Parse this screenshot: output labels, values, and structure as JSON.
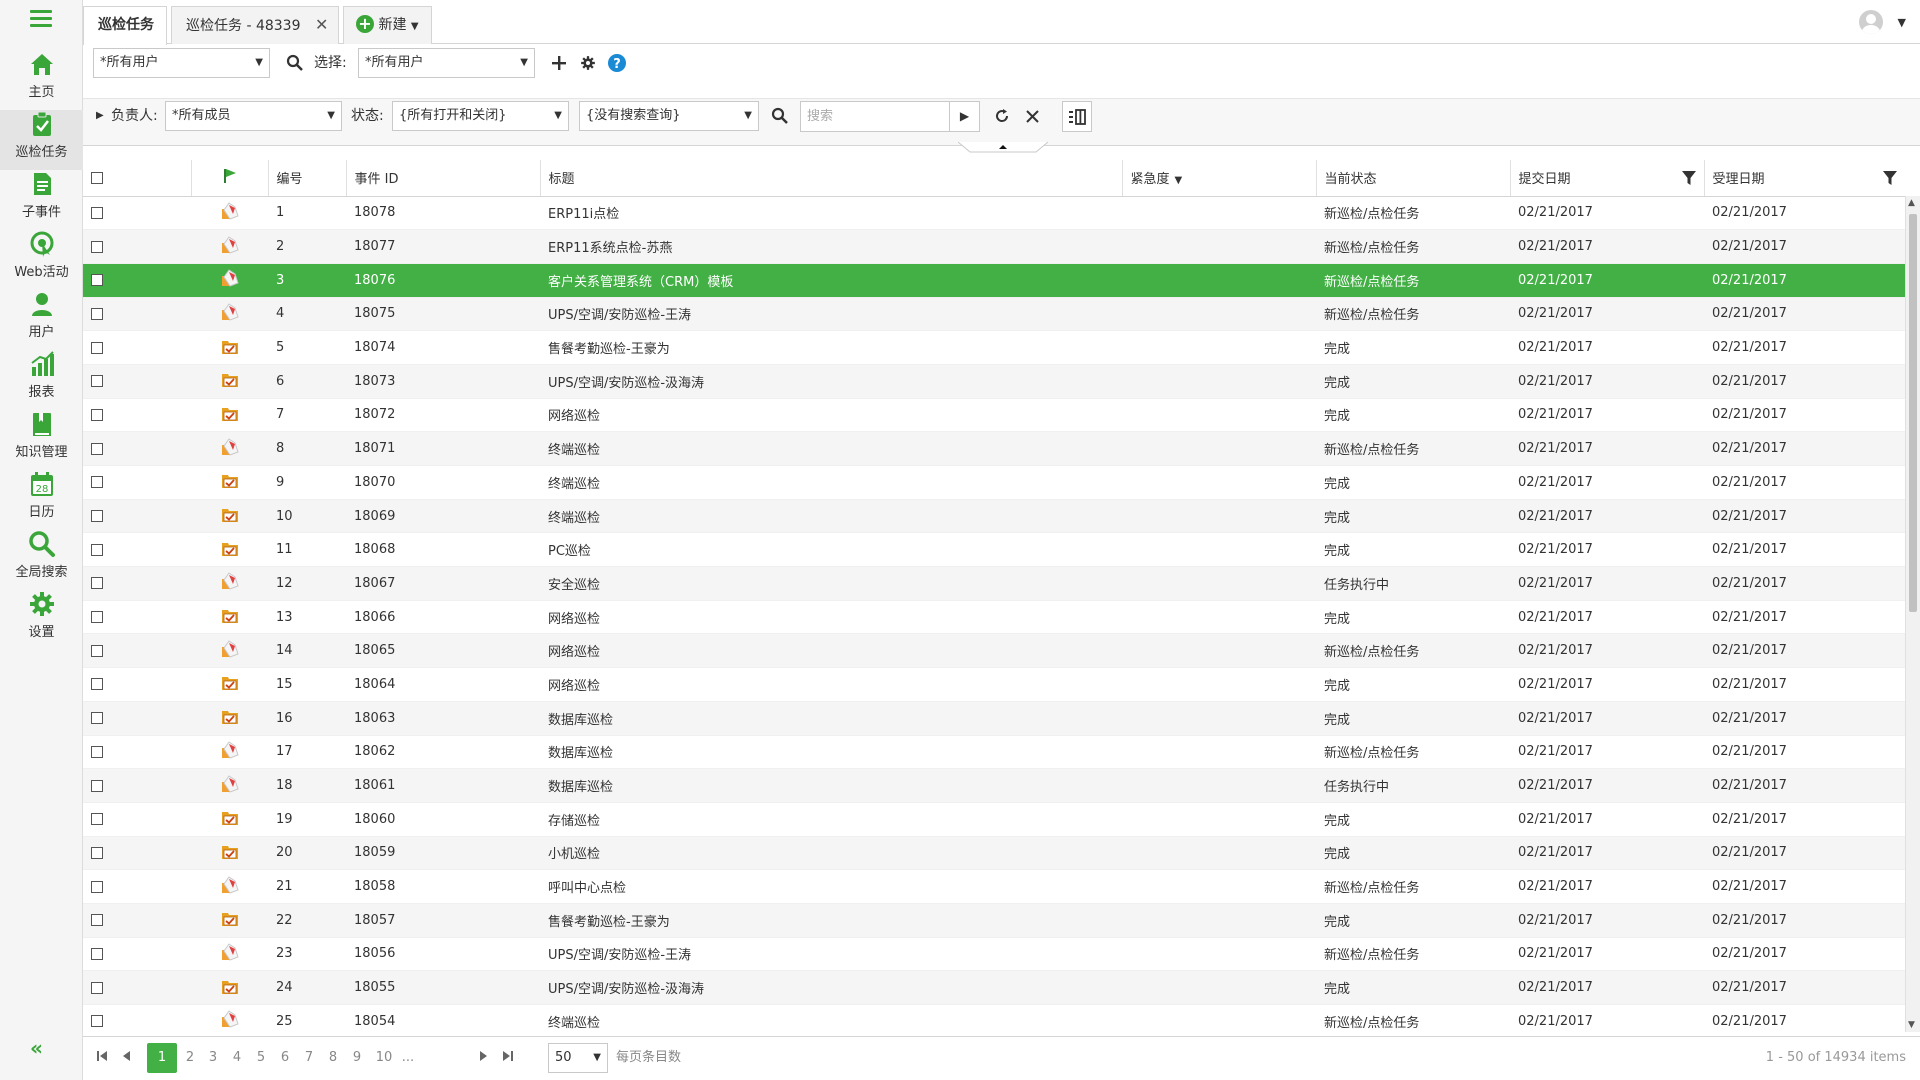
{
  "sidebar": {
    "items": [
      {
        "label": "主页",
        "icon": "home-icon"
      },
      {
        "label": "巡检任务",
        "icon": "clipboard-check-icon"
      },
      {
        "label": "子事件",
        "icon": "document-icon"
      },
      {
        "label": "Web活动",
        "icon": "web-activity-icon"
      },
      {
        "label": "用户",
        "icon": "user-icon"
      },
      {
        "label": "报表",
        "icon": "bar-chart-icon"
      },
      {
        "label": "知识管理",
        "icon": "book-icon"
      },
      {
        "label": "日历",
        "icon": "calendar-icon"
      },
      {
        "label": "全局搜索",
        "icon": "search-icon"
      },
      {
        "label": "设置",
        "icon": "gear-icon"
      }
    ],
    "calendar_day": "28",
    "collapse_label": "«"
  },
  "tabs": {
    "tab1": "巡检任务",
    "tab2": "巡检任务 - 48339",
    "tab2_close": "✕",
    "new_label": "新建"
  },
  "toolbar1": {
    "user_filter": "*所有用户",
    "select_label": "选择:",
    "select_value": "*所有用户"
  },
  "toolbar2": {
    "owner_label": "负责人:",
    "owner_value": "*所有成员",
    "status_label": "状态:",
    "status_value": "{所有打开和关闭}",
    "query_value": "{没有搜索查询}",
    "search_placeholder": "搜索"
  },
  "columns": {
    "number": "编号",
    "event_id": "事件 ID",
    "title": "标题",
    "urgency": "紧急度",
    "status": "当前状态",
    "submit_date": "提交日期",
    "accept_date": "受理日期"
  },
  "colors": {
    "accent": "#43b045",
    "brand": "#3aa63a"
  },
  "rows": [
    {
      "no": "1",
      "id": "18078",
      "title": "ERP11i点检",
      "status": "新巡检/点检任务",
      "submitted": "02/21/2017",
      "accepted": "02/21/2017",
      "icon": "new-task-icon"
    },
    {
      "no": "2",
      "id": "18077",
      "title": "ERP11系统点检-苏燕",
      "status": "新巡检/点检任务",
      "submitted": "02/21/2017",
      "accepted": "02/21/2017",
      "icon": "new-task-icon"
    },
    {
      "no": "3",
      "id": "18076",
      "title": "客户关系管理系统（CRM）模板",
      "status": "新巡检/点检任务",
      "submitted": "02/21/2017",
      "accepted": "02/21/2017",
      "icon": "new-task-icon"
    },
    {
      "no": "4",
      "id": "18075",
      "title": "UPS/空调/安防巡检-王涛",
      "status": "新巡检/点检任务",
      "submitted": "02/21/2017",
      "accepted": "02/21/2017",
      "icon": "new-task-icon"
    },
    {
      "no": "5",
      "id": "18074",
      "title": "售餐考勤巡检-王豪为",
      "status": "完成",
      "submitted": "02/21/2017",
      "accepted": "02/21/2017",
      "icon": "completed-task-icon"
    },
    {
      "no": "6",
      "id": "18073",
      "title": "UPS/空调/安防巡检-汲海涛",
      "status": "完成",
      "submitted": "02/21/2017",
      "accepted": "02/21/2017",
      "icon": "completed-task-icon"
    },
    {
      "no": "7",
      "id": "18072",
      "title": "网络巡检",
      "status": "完成",
      "submitted": "02/21/2017",
      "accepted": "02/21/2017",
      "icon": "completed-task-icon"
    },
    {
      "no": "8",
      "id": "18071",
      "title": "终端巡检",
      "status": "新巡检/点检任务",
      "submitted": "02/21/2017",
      "accepted": "02/21/2017",
      "icon": "new-task-icon"
    },
    {
      "no": "9",
      "id": "18070",
      "title": "终端巡检",
      "status": "完成",
      "submitted": "02/21/2017",
      "accepted": "02/21/2017",
      "icon": "completed-task-icon"
    },
    {
      "no": "10",
      "id": "18069",
      "title": "终端巡检",
      "status": "完成",
      "submitted": "02/21/2017",
      "accepted": "02/21/2017",
      "icon": "completed-task-icon"
    },
    {
      "no": "11",
      "id": "18068",
      "title": "PC巡检",
      "status": "完成",
      "submitted": "02/21/2017",
      "accepted": "02/21/2017",
      "icon": "completed-task-icon"
    },
    {
      "no": "12",
      "id": "18067",
      "title": "安全巡检",
      "status": "任务执行中",
      "submitted": "02/21/2017",
      "accepted": "02/21/2017",
      "icon": "new-task-icon"
    },
    {
      "no": "13",
      "id": "18066",
      "title": "网络巡检",
      "status": "完成",
      "submitted": "02/21/2017",
      "accepted": "02/21/2017",
      "icon": "completed-task-icon"
    },
    {
      "no": "14",
      "id": "18065",
      "title": "网络巡检",
      "status": "新巡检/点检任务",
      "submitted": "02/21/2017",
      "accepted": "02/21/2017",
      "icon": "new-task-icon"
    },
    {
      "no": "15",
      "id": "18064",
      "title": "网络巡检",
      "status": "完成",
      "submitted": "02/21/2017",
      "accepted": "02/21/2017",
      "icon": "completed-task-icon"
    },
    {
      "no": "16",
      "id": "18063",
      "title": "数据库巡检",
      "status": "完成",
      "submitted": "02/21/2017",
      "accepted": "02/21/2017",
      "icon": "completed-task-icon"
    },
    {
      "no": "17",
      "id": "18062",
      "title": "数据库巡检",
      "status": "新巡检/点检任务",
      "submitted": "02/21/2017",
      "accepted": "02/21/2017",
      "icon": "new-task-icon"
    },
    {
      "no": "18",
      "id": "18061",
      "title": "数据库巡检",
      "status": "任务执行中",
      "submitted": "02/21/2017",
      "accepted": "02/21/2017",
      "icon": "new-task-icon"
    },
    {
      "no": "19",
      "id": "18060",
      "title": "存储巡检",
      "status": "完成",
      "submitted": "02/21/2017",
      "accepted": "02/21/2017",
      "icon": "completed-task-icon"
    },
    {
      "no": "20",
      "id": "18059",
      "title": "小机巡检",
      "status": "完成",
      "submitted": "02/21/2017",
      "accepted": "02/21/2017",
      "icon": "completed-task-icon"
    },
    {
      "no": "21",
      "id": "18058",
      "title": "呼叫中心点检",
      "status": "新巡检/点检任务",
      "submitted": "02/21/2017",
      "accepted": "02/21/2017",
      "icon": "new-task-icon"
    },
    {
      "no": "22",
      "id": "18057",
      "title": "售餐考勤巡检-王豪为",
      "status": "完成",
      "submitted": "02/21/2017",
      "accepted": "02/21/2017",
      "icon": "completed-task-icon"
    },
    {
      "no": "23",
      "id": "18056",
      "title": "UPS/空调/安防巡检-王涛",
      "status": "新巡检/点检任务",
      "submitted": "02/21/2017",
      "accepted": "02/21/2017",
      "icon": "new-task-icon"
    },
    {
      "no": "24",
      "id": "18055",
      "title": "UPS/空调/安防巡检-汲海涛",
      "status": "完成",
      "submitted": "02/21/2017",
      "accepted": "02/21/2017",
      "icon": "completed-task-icon"
    },
    {
      "no": "25",
      "id": "18054",
      "title": "终端巡检",
      "status": "新巡检/点检任务",
      "submitted": "02/21/2017",
      "accepted": "02/21/2017",
      "icon": "new-task-icon"
    }
  ],
  "selected_row": 3,
  "pager": {
    "pages": [
      "1",
      "2",
      "3",
      "4",
      "5",
      "6",
      "7",
      "8",
      "9",
      "10",
      "..."
    ],
    "current": "1",
    "page_size": "50",
    "page_size_label": "每页条目数",
    "info": "1 - 50 of 14934 items"
  }
}
